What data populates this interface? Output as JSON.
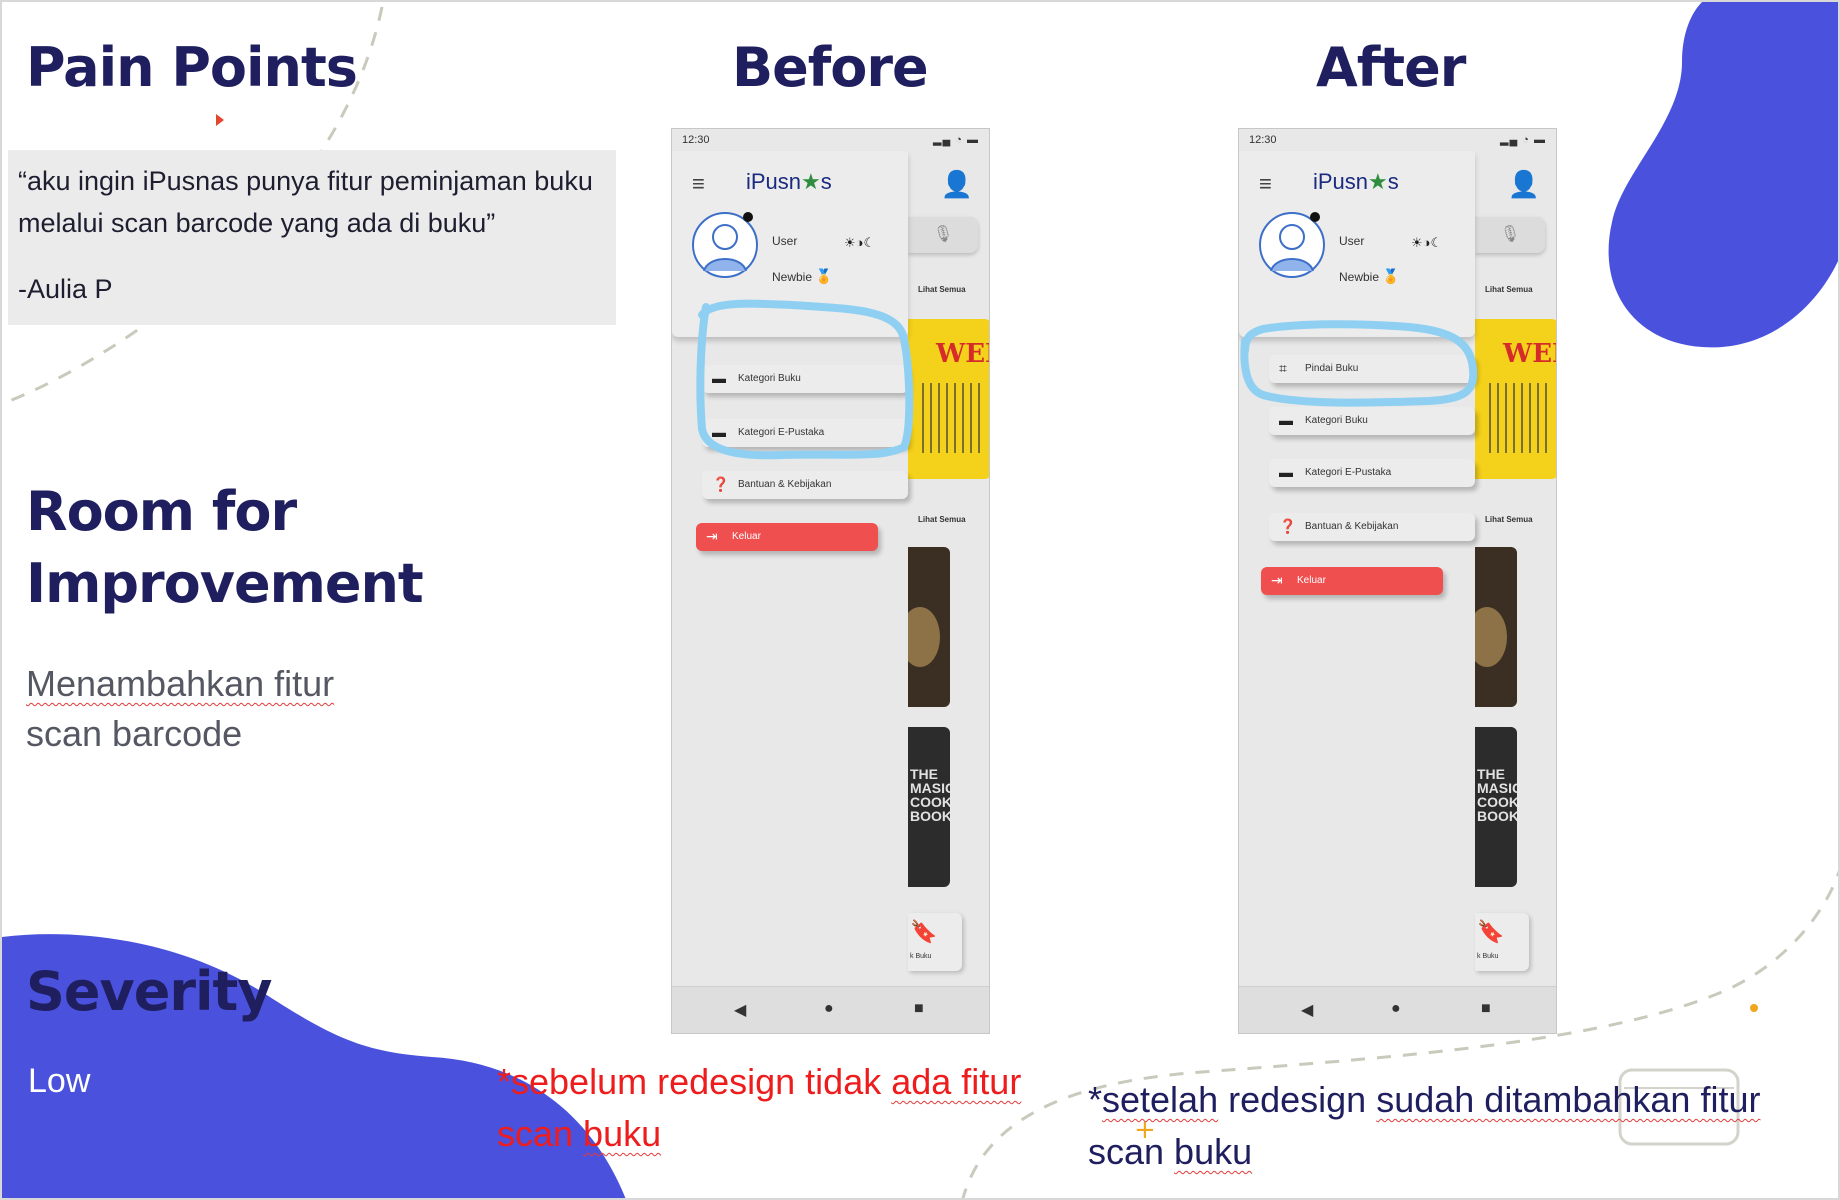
{
  "slide": {
    "pain_points": {
      "title": "Pain Points",
      "quote": "“aku ingin iPusnas punya fitur peminjaman buku melalui scan barcode yang ada di buku”",
      "author": "-Aulia P"
    },
    "room": {
      "title_line1": "Room for",
      "title_line2": "Improvement",
      "body_line1": "Menambahkan fitur",
      "body_line2": "scan barcode"
    },
    "severity": {
      "title": "Severity",
      "value": "Low"
    },
    "before_title": "Before",
    "after_title": "After",
    "before_note": {
      "line1_a": "*sebelum redesign tidak ",
      "line1_b": "ada fitur",
      "line2_a": "scan ",
      "line2_b": "buku"
    },
    "after_note": {
      "line1_a": "*",
      "line1_b": "setelah",
      "line1_c": " redesign ",
      "line1_d": "sudah ditambahkan fitur",
      "line2_a": "scan ",
      "line2_b": "buku"
    },
    "colors": {
      "navy": "#1f1e5e",
      "blob_blue": "#4a52dd",
      "note_red": "#ee1c1c",
      "highlight_blue": "#8fd0f2",
      "logout_red": "#f04f4f"
    }
  },
  "phone_common": {
    "time": "12:30",
    "signal_icons": "signal-wifi-battery",
    "app_logo_a": "iPusn",
    "app_logo_star": "★",
    "app_logo_b": "s",
    "user_name": "User",
    "user_level": "Newbie",
    "see_all": "Lihat Semua",
    "bookmark_label": "k Buku",
    "book1_title": "WEB",
    "book3_title": "THE MASIC COOK BOOK"
  },
  "before_phone": {
    "menu": [
      {
        "label": "Kategori Buku",
        "icon": "book-icon"
      },
      {
        "label": "Kategori E-Pustaka",
        "icon": "book-icon"
      },
      {
        "label": "Bantuan & Kebijakan",
        "icon": "help-icon"
      },
      {
        "label": "Keluar",
        "icon": "logout-icon"
      }
    ]
  },
  "after_phone": {
    "menu": [
      {
        "label": "Pindai Buku",
        "icon": "scan-icon"
      },
      {
        "label": "Kategori Buku",
        "icon": "book-icon"
      },
      {
        "label": "Kategori E-Pustaka",
        "icon": "book-icon"
      },
      {
        "label": "Bantuan & Kebijakan",
        "icon": "help-icon"
      },
      {
        "label": "Keluar",
        "icon": "logout-icon"
      }
    ]
  }
}
